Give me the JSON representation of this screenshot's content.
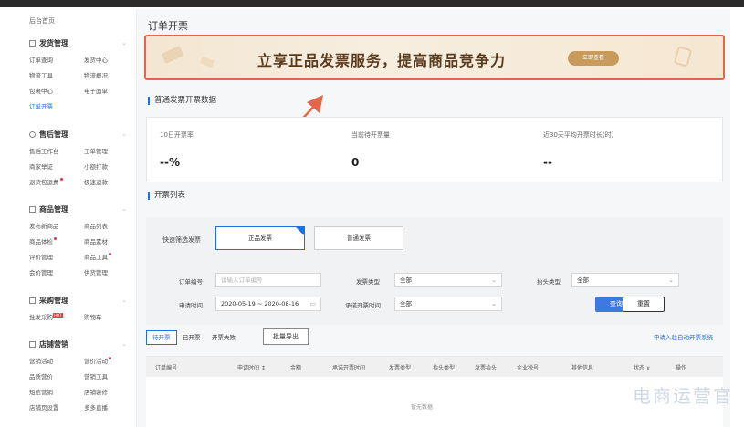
{
  "sidebar": {
    "home": "后台首页",
    "sections": [
      {
        "title": "发货管理",
        "items": [
          "订单查询",
          "发货中心",
          "物流工具",
          "物流概况",
          "包裹中心",
          "电子面单",
          "订单开票"
        ]
      },
      {
        "title": "售后管理",
        "items": [
          "售后工作台",
          "工单管理",
          "商家举证",
          "小额打款",
          "退货包运费",
          "极速退款"
        ]
      },
      {
        "title": "商品管理",
        "items": [
          "发布新商品",
          "商品列表",
          "商品体检",
          "商品素材",
          "评价管理",
          "商品工具",
          "会价管理",
          "供货管理"
        ]
      },
      {
        "title": "采购管理",
        "items": [
          "批发采购",
          "购物车"
        ]
      },
      {
        "title": "店铺营销",
        "items": [
          "营销活动",
          "营价活动",
          "品质营价",
          "营销工具",
          "短信营销",
          "店铺装修",
          "店铺页设置",
          "多多直播"
        ]
      }
    ],
    "active_item": "订单开票",
    "hot_badge": "HOT"
  },
  "page": {
    "title": "订单开票"
  },
  "banner": {
    "text": "立享正品发票服务，提高商品竞争力",
    "button": "立即查看"
  },
  "stats_section": {
    "title": "普通发票开票数据",
    "items": [
      {
        "label": "10日开票率",
        "value": "--%"
      },
      {
        "label": "当前待开票量",
        "value": "0"
      },
      {
        "label": "近30天平均开票时长(时)",
        "value": "--"
      }
    ]
  },
  "list_section": {
    "title": "开票列表",
    "quick_filter": {
      "label": "快速筛选发票",
      "options": [
        "正品发票",
        "普通发票"
      ],
      "selected": "正品发票"
    },
    "fields": {
      "order_no": {
        "label": "订单编号",
        "placeholder": "请输入订单编号"
      },
      "invoice_type": {
        "label": "发票类型",
        "value": "全部"
      },
      "title_type": {
        "label": "抬头类型",
        "value": "全部"
      },
      "apply_time": {
        "label": "申请时间",
        "value": "2020-05-19 ~ 2020-08-16"
      },
      "promise_time": {
        "label": "承诺开票时间",
        "value": "全部"
      }
    },
    "search_button": "查询",
    "reset_button": "重置"
  },
  "tabs": [
    "待开票",
    "已开票",
    "开票失败"
  ],
  "export_button": "批量导出",
  "right_link": "申请入驻自动开票系统",
  "table": {
    "columns": [
      "订单编号",
      "申请时间 ↕",
      "金额",
      "承诺开票时间",
      "发票类型",
      "抬头类型",
      "发票抬头",
      "企业税号",
      "其他信息",
      "状态 ∨",
      "操作"
    ],
    "empty_text": "暂无数据"
  },
  "watermark": "电商运营官",
  "colors": {
    "accent": "#1f6fe0",
    "banner_border": "#e2674a",
    "arrow": "#e2674a",
    "primary_button": "#3f78e0"
  }
}
